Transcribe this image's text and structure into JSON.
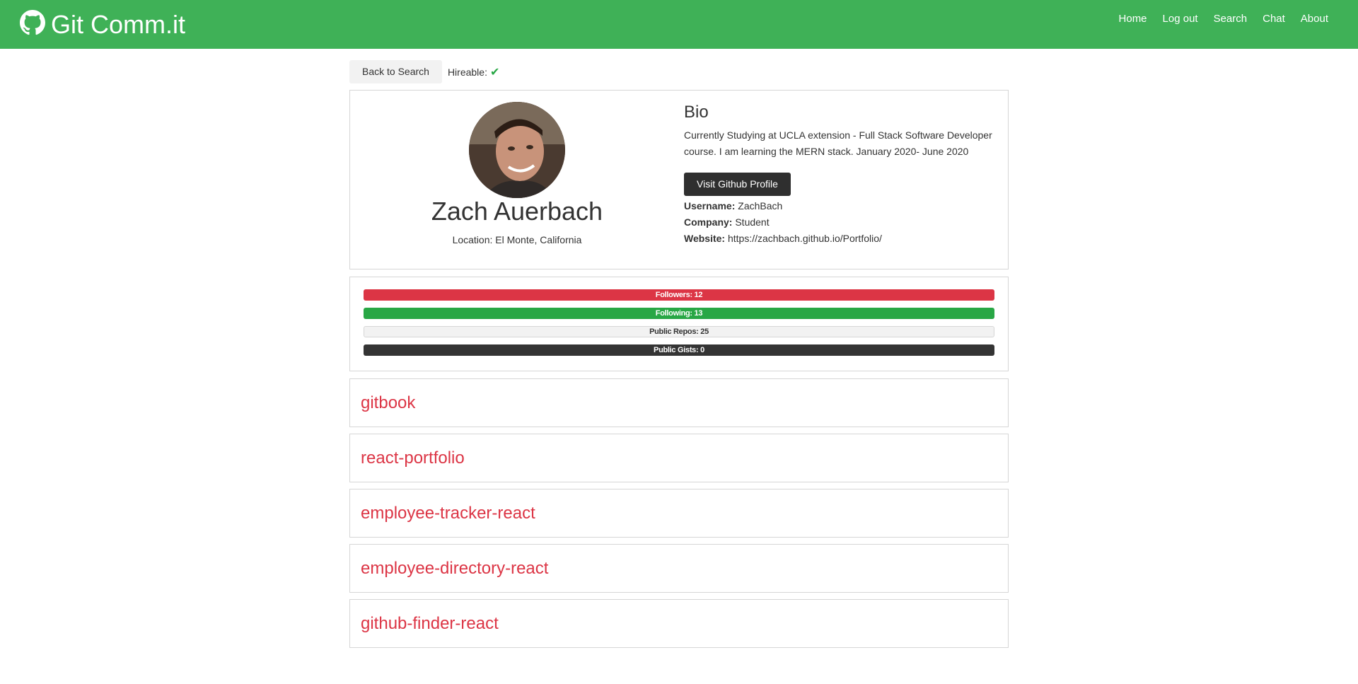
{
  "navbar": {
    "brand": "Git Comm.it",
    "links": [
      "Home",
      "Log out",
      "Search",
      "Chat",
      "About"
    ]
  },
  "topbar": {
    "back_label": "Back to Search",
    "hireable_label": "Hireable:"
  },
  "profile": {
    "name": "Zach Auerbach",
    "location": "Location: El Monte, California",
    "bio_title": "Bio",
    "bio_text": "Currently Studying at UCLA extension - Full Stack Software Developer course. I am learning the MERN stack. January 2020- June 2020",
    "github_button": "Visit Github Profile",
    "username_label": "Username:",
    "username": "ZachBach",
    "company_label": "Company:",
    "company": "Student",
    "website_label": "Website:",
    "website": "https://zachbach.github.io/Portfolio/"
  },
  "stats": {
    "followers": "Followers: 12",
    "following": "Following: 13",
    "public_repos": "Public Repos: 25",
    "public_gists": "Public Gists: 0"
  },
  "repos": [
    "gitbook",
    "react-portfolio",
    "employee-tracker-react",
    "employee-directory-react",
    "github-finder-react"
  ],
  "colors": {
    "navbar": "#3fb157",
    "followers": "#dc3545",
    "following": "#28a745",
    "public_repos": "#f2f2f2",
    "public_gists": "#343434",
    "repo_link": "#dc3545"
  }
}
